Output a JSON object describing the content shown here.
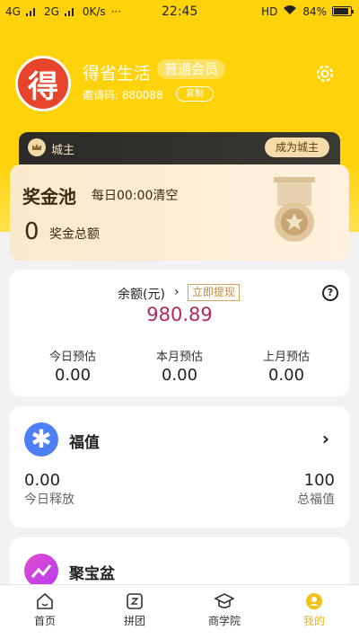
{
  "status_bar": {
    "network_left": "4G",
    "network_right": "2G",
    "speed": "0K/s",
    "more": "···",
    "time": "22:45",
    "hd": "HD",
    "battery": "84%"
  },
  "profile": {
    "avatar_char": "得",
    "name": "得省生活",
    "member_level": "普通会员",
    "invite_label": "邀请码: 880088",
    "copy_label": "复制"
  },
  "banner": {
    "label": "城主",
    "button": "成为城主"
  },
  "prize_pool": {
    "title": "奖金池",
    "subtitle": "每日00:00清空",
    "amount": "0",
    "amount_label": "奖金总额"
  },
  "balance": {
    "label": "余额(元)",
    "chevron": "›",
    "withdraw": "立即提现",
    "help": "?",
    "amount": "980.89",
    "columns": [
      {
        "title": "今日预估",
        "value": "0.00"
      },
      {
        "title": "本月预估",
        "value": "0.00"
      },
      {
        "title": "上月预估",
        "value": "0.00"
      }
    ]
  },
  "fuzhi": {
    "title": "福值",
    "arrow": "›",
    "left_value": "0.00",
    "left_label": "今日释放",
    "right_value": "100",
    "right_label": "总福值"
  },
  "jubaopen": {
    "title": "聚宝盆"
  },
  "tabs": [
    {
      "label": "首页",
      "icon": "home-icon"
    },
    {
      "label": "拼团",
      "icon": "group-icon"
    },
    {
      "label": "商学院",
      "icon": "academy-icon"
    },
    {
      "label": "我的",
      "icon": "profile-icon"
    }
  ],
  "colors": {
    "header_yellow": "#ffd20a",
    "balance_amount": "#b0285e",
    "active_tab": "#e7b51c"
  }
}
